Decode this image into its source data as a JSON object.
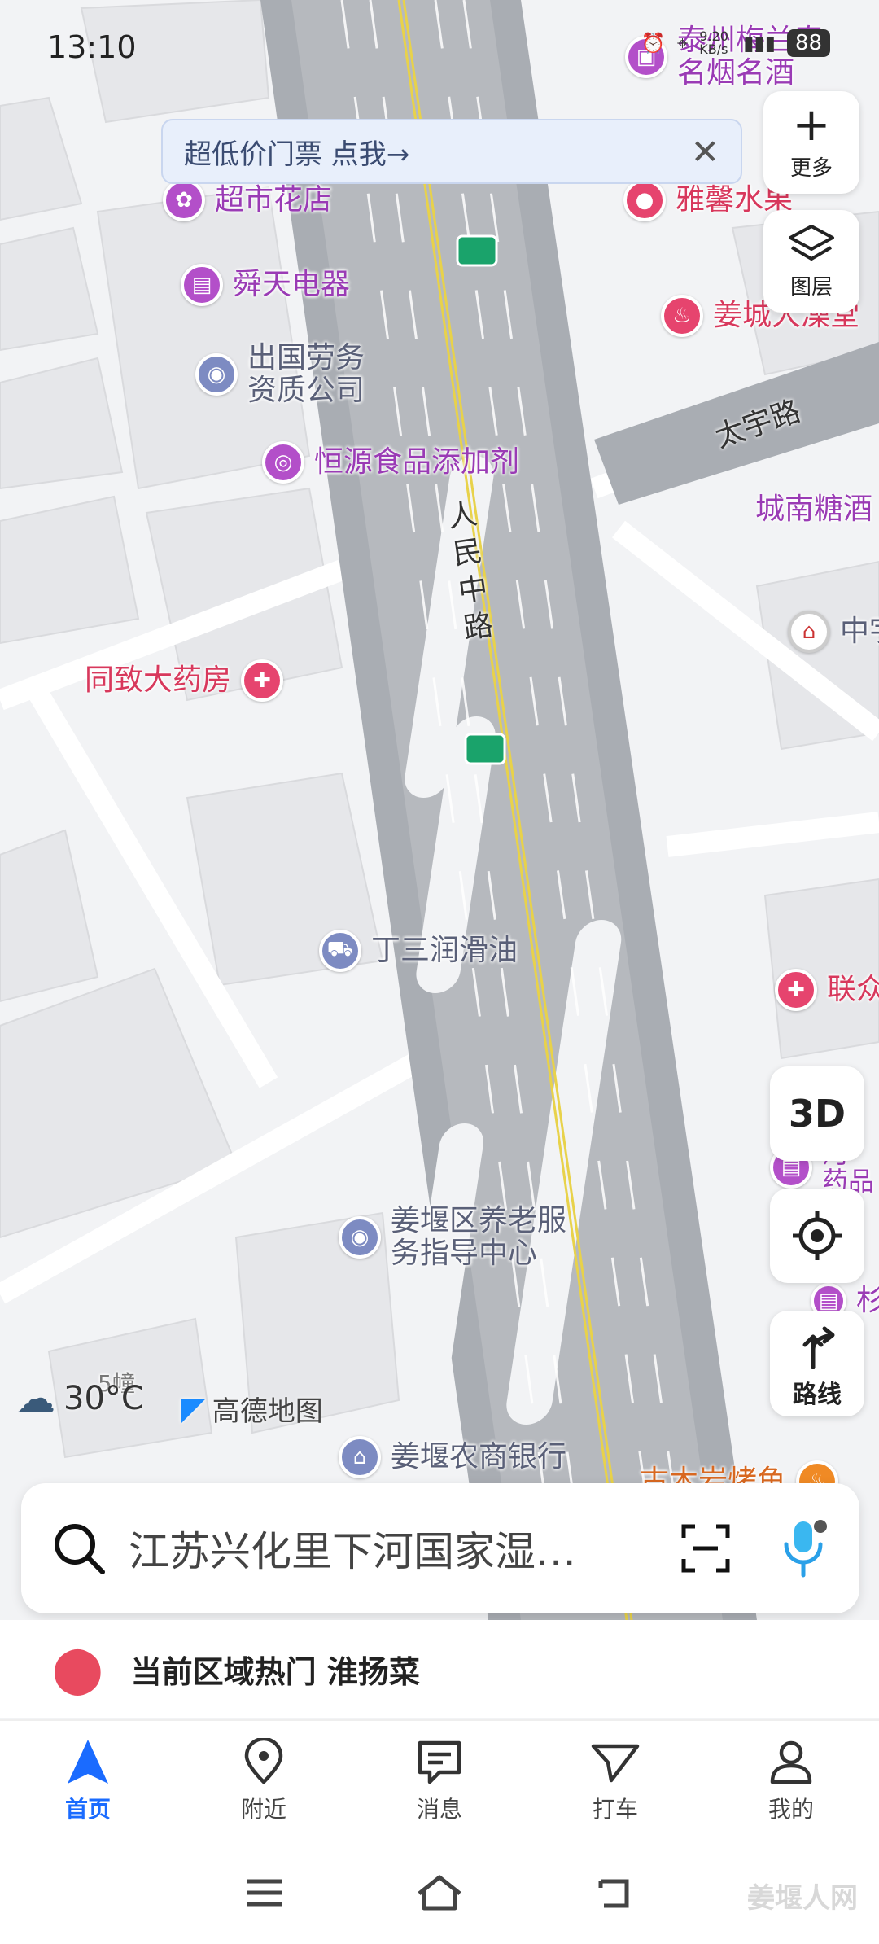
{
  "status_bar": {
    "time": "13:10",
    "net_speed": "9.20 KB/s",
    "battery": "88"
  },
  "promo": {
    "text": "超低价门票 点我→"
  },
  "side_buttons": {
    "more": "更多",
    "layers": "图层",
    "mode_3d": "3D",
    "route": "路线"
  },
  "roads": {
    "main": "人民中路",
    "cross": "太宇路"
  },
  "pois": [
    {
      "name": "泰州梅兰春\n名烟名酒",
      "color": "purple"
    },
    {
      "name": "超市花店",
      "color": "purple"
    },
    {
      "name": "雅馨水果",
      "color": "pink"
    },
    {
      "name": "舜天电器",
      "color": "purple"
    },
    {
      "name": "姜城大澡堂",
      "color": "pink"
    },
    {
      "name": "出国劳务\n资质公司",
      "color": "blue"
    },
    {
      "name": "恒源食品添加剂",
      "color": "purple"
    },
    {
      "name": "城南糖酒",
      "color": "purple"
    },
    {
      "name": "中宇",
      "color": "blue"
    },
    {
      "name": "同致大药房",
      "color": "pink"
    },
    {
      "name": "丁三润滑油",
      "color": "blue"
    },
    {
      "name": "联众",
      "color": "pink"
    },
    {
      "name": "河\n药品",
      "color": "purple"
    },
    {
      "name": "姜堰区养老服\n务指导中心",
      "color": "blue"
    },
    {
      "name": "杉",
      "color": "purple"
    },
    {
      "name": "姜堰农商银行",
      "color": "blue"
    },
    {
      "name": "古木岩烤鱼",
      "color": "orange"
    },
    {
      "name": "5幢",
      "color": "blue"
    }
  ],
  "weather": {
    "temp": "30°C"
  },
  "brand": {
    "name": "高德地图"
  },
  "search": {
    "text": "江苏兴化里下河国家湿…"
  },
  "hot": {
    "text": "当前区域热门 淮扬菜"
  },
  "tabs": [
    {
      "label": "首页",
      "icon": "navigate-icon"
    },
    {
      "label": "附近",
      "icon": "location-pin-icon"
    },
    {
      "label": "消息",
      "icon": "message-icon"
    },
    {
      "label": "打车",
      "icon": "taxi-icon"
    },
    {
      "label": "我的",
      "icon": "user-icon"
    }
  ],
  "watermark": "姜堰人网",
  "colors": {
    "accent": "#1a6bff",
    "road": "#a9adb3",
    "road_line": "#e8d24a"
  }
}
